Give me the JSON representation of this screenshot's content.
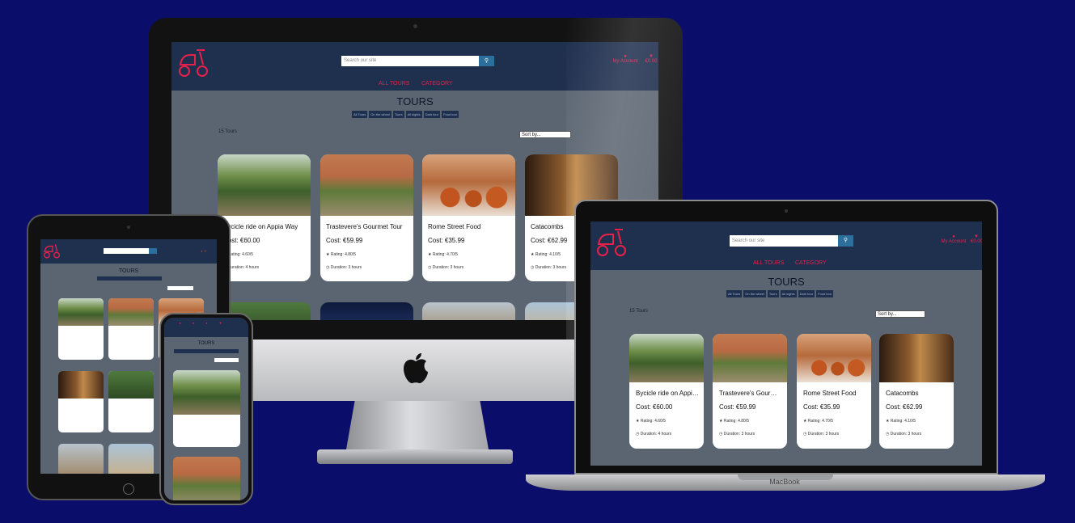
{
  "site": {
    "search_placeholder": "Search our site",
    "search_icon": "search-icon",
    "account_label": "My Account",
    "bag_total": "€0.00",
    "nav": [
      "ALL TOURS",
      "CATEGORY"
    ],
    "page_title": "TOURS",
    "filters": [
      "All Tours",
      "On the wheel",
      "Tours",
      "All sights",
      "Dark tour",
      "Food tour"
    ],
    "tour_count": "15 Tours",
    "sort_label": "Sort by..."
  },
  "tours": [
    {
      "name": "Bycicle ride on Appia Way",
      "cost": "Cost: €60.00",
      "rating": "Rating: 4.60/5",
      "duration": "Duration: 4 hours"
    },
    {
      "name": "Trastevere's Gourmet Tour",
      "cost": "Cost: €59.99",
      "rating": "Rating: 4.80/5",
      "duration": "Duration: 3 hours"
    },
    {
      "name": "Rome Street Food",
      "cost": "Cost: €35.99",
      "rating": "Rating: 4.70/5",
      "duration": "Duration: 3 hours"
    },
    {
      "name": "Catacombs",
      "cost": "Cost: €62.99",
      "rating": "Rating: 4.10/5",
      "duration": "Duration: 3 hours"
    }
  ],
  "devices": {
    "laptop_label": "MacBook"
  },
  "colors": {
    "background": "#0b0d6b",
    "header": "#1f2f4e",
    "accent": "#e8214b",
    "page": "#5b6571"
  }
}
